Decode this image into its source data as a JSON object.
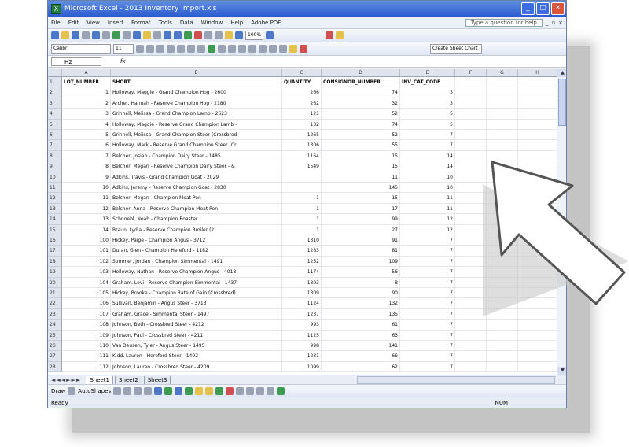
{
  "window": {
    "title": "Microsoft Excel - 2013 Inventory Import.xls",
    "controls": [
      "_",
      "□",
      "×"
    ]
  },
  "menu": {
    "items": [
      "File",
      "Edit",
      "View",
      "Insert",
      "Format",
      "Tools",
      "Data",
      "Window",
      "Help",
      "Adobe PDF"
    ],
    "help_placeholder": "Type a question for help"
  },
  "toolbar": {
    "zoom": "100%",
    "font_name": "Calibri",
    "font_size": "11",
    "create_sheet_label": "Create Sheet Chart"
  },
  "formula_bar": {
    "name_box": "H2",
    "fx_label": "fx",
    "content": ""
  },
  "columns": [
    "A",
    "B",
    "C",
    "D",
    "E",
    "F",
    "G",
    "H"
  ],
  "rows": [
    {
      "n": "1",
      "a": "LOT_NUMBER",
      "b": "SHORT",
      "c": "QUANTITY",
      "d": "CONSIGNOR_NUMBER",
      "e": "INV_CAT_CODE"
    },
    {
      "n": "2",
      "a": "1",
      "b": "Holloway, Maggie - Grand Champion Hog - 2600",
      "c": "266",
      "d": "74",
      "e": "3"
    },
    {
      "n": "3",
      "a": "2",
      "b": "Archer, Hannah - Reserve Champion Hog - 2180",
      "c": "262",
      "d": "32",
      "e": "3"
    },
    {
      "n": "4",
      "a": "3",
      "b": "Grinnell, Melissa - Grand Champion Lamb - 2623",
      "c": "121",
      "d": "52",
      "e": "5"
    },
    {
      "n": "5",
      "a": "4",
      "b": "Holloway, Maggie - Reserve Grand Champion Lamb -",
      "c": "132",
      "d": "74",
      "e": "5"
    },
    {
      "n": "6",
      "a": "5",
      "b": "Grinnell, Melissa - Grand Champion Steer (Crossbred",
      "c": "1265",
      "d": "52",
      "e": "7"
    },
    {
      "n": "7",
      "a": "6",
      "b": "Holloway, Mark - Reserve Grand Champion Steer (Cr",
      "c": "1306",
      "d": "55",
      "e": "7"
    },
    {
      "n": "8",
      "a": "7",
      "b": "Belcher, Josiah - Champion Dairy Steer - 1485",
      "c": "1164",
      "d": "15",
      "e": "14"
    },
    {
      "n": "9",
      "a": "8",
      "b": "Belcher, Megan - Reserve Champion Dairy Steer - &",
      "c": "1549",
      "d": "15",
      "e": "14"
    },
    {
      "n": "10",
      "a": "9",
      "b": "Adkins, Travis - Grand Champion Goat - 2029",
      "c": "",
      "d": "11",
      "e": "10"
    },
    {
      "n": "11",
      "a": "10",
      "b": "Adkins, Jeremy - Reserve Champion Goat - 2830",
      "c": "",
      "d": "145",
      "e": "10"
    },
    {
      "n": "12",
      "a": "11",
      "b": "Belcher, Megan - Champion Meat Pen",
      "c": "1",
      "d": "15",
      "e": "11"
    },
    {
      "n": "13",
      "a": "12",
      "b": "Belcher, Anna - Reserve Champion Meat Pen",
      "c": "1",
      "d": "17",
      "e": "11"
    },
    {
      "n": "14",
      "a": "13",
      "b": "Schnoebl, Noah - Champion Roaster",
      "c": "1",
      "d": "99",
      "e": "12"
    },
    {
      "n": "15",
      "a": "14",
      "b": "Braun, Lydia - Reserve Champion Broiler (2)",
      "c": "1",
      "d": "27",
      "e": "12"
    },
    {
      "n": "16",
      "a": "100",
      "b": "Hickey, Paige - Champion Angus - 3712",
      "c": "1310",
      "d": "91",
      "e": "7"
    },
    {
      "n": "17",
      "a": "101",
      "b": "Duran, Glen - Champion Hereford - 1182",
      "c": "1283",
      "d": "81",
      "e": "7"
    },
    {
      "n": "18",
      "a": "102",
      "b": "Sommer, Jordan - Champion Simmental - 1491",
      "c": "1252",
      "d": "109",
      "e": "7"
    },
    {
      "n": "19",
      "a": "103",
      "b": "Holloway, Nathan - Reserve Champion Angus - 4018",
      "c": "1174",
      "d": "56",
      "e": "7"
    },
    {
      "n": "20",
      "a": "104",
      "b": "Graham, Levi - Reserve Champion Simmental - 1437",
      "c": "1303",
      "d": "8",
      "e": "7"
    },
    {
      "n": "21",
      "a": "105",
      "b": "Hickey, Brooke - Champion Rate of Gain (Crossbred)",
      "c": "1309",
      "d": "90",
      "e": "7"
    },
    {
      "n": "22",
      "a": "106",
      "b": "Sullivan, Benjamin - Angus Steer - 3713",
      "c": "1124",
      "d": "132",
      "e": "7"
    },
    {
      "n": "23",
      "a": "107",
      "b": "Graham, Grace - Simmental Steer - 1497",
      "c": "1237",
      "d": "135",
      "e": "7"
    },
    {
      "n": "24",
      "a": "108",
      "b": "Johnson, Beth - Crossbred Steer - 4212",
      "c": "993",
      "d": "61",
      "e": "7"
    },
    {
      "n": "25",
      "a": "109",
      "b": "Johnson, Paul - Crossbred Steer - 4211",
      "c": "1125",
      "d": "63",
      "e": "7"
    },
    {
      "n": "26",
      "a": "110",
      "b": "Van Deusen, Tyler - Angus Steer - 1495",
      "c": "998",
      "d": "141",
      "e": "7"
    },
    {
      "n": "27",
      "a": "111",
      "b": "Kidd, Lauren - Hereford Steer - 1492",
      "c": "1231",
      "d": "66",
      "e": "7"
    },
    {
      "n": "28",
      "a": "112",
      "b": "Johnson, Lauren - Crossbred Steer - 4209",
      "c": "1099",
      "d": "62",
      "e": "7"
    }
  ],
  "sheet_tabs": [
    "Sheet1",
    "Sheet2",
    "Sheet3"
  ],
  "draw_toolbar": {
    "draw_label": "Draw",
    "autoshapes_label": "AutoShapes"
  },
  "status": {
    "left": "Ready",
    "right": "NUM"
  },
  "colors": {
    "titlebar": "#2b5bd0",
    "excel_green": "#1e7d3a"
  },
  "icons": [
    "excel-logo-icon",
    "pointer-arrow-icon"
  ]
}
